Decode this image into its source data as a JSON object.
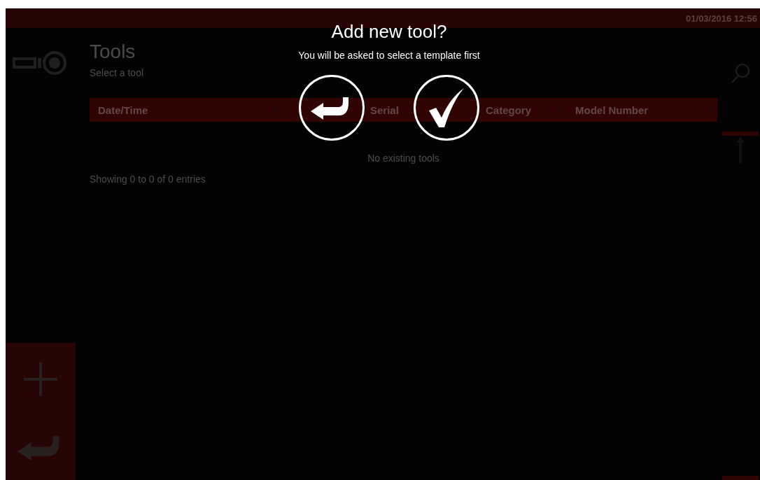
{
  "status_bar": {
    "datetime": "01/03/2016 12:56"
  },
  "page": {
    "title": "Tools",
    "subtitle": "Select a tool"
  },
  "table": {
    "columns": [
      {
        "label": "Date/Time"
      },
      {
        "label": "Serial"
      },
      {
        "label": "Category"
      },
      {
        "label": "Model Number"
      }
    ],
    "empty_message": "No existing tools",
    "info": "Showing 0 to 0 of 0 entries"
  },
  "sidebar": {
    "actions": [
      {
        "kind": "add"
      },
      {
        "kind": "back"
      }
    ]
  },
  "dialog": {
    "title": "Add new tool?",
    "message": "You will be asked to select a template first",
    "buttons": [
      {
        "kind": "cancel"
      },
      {
        "kind": "confirm"
      }
    ]
  }
}
